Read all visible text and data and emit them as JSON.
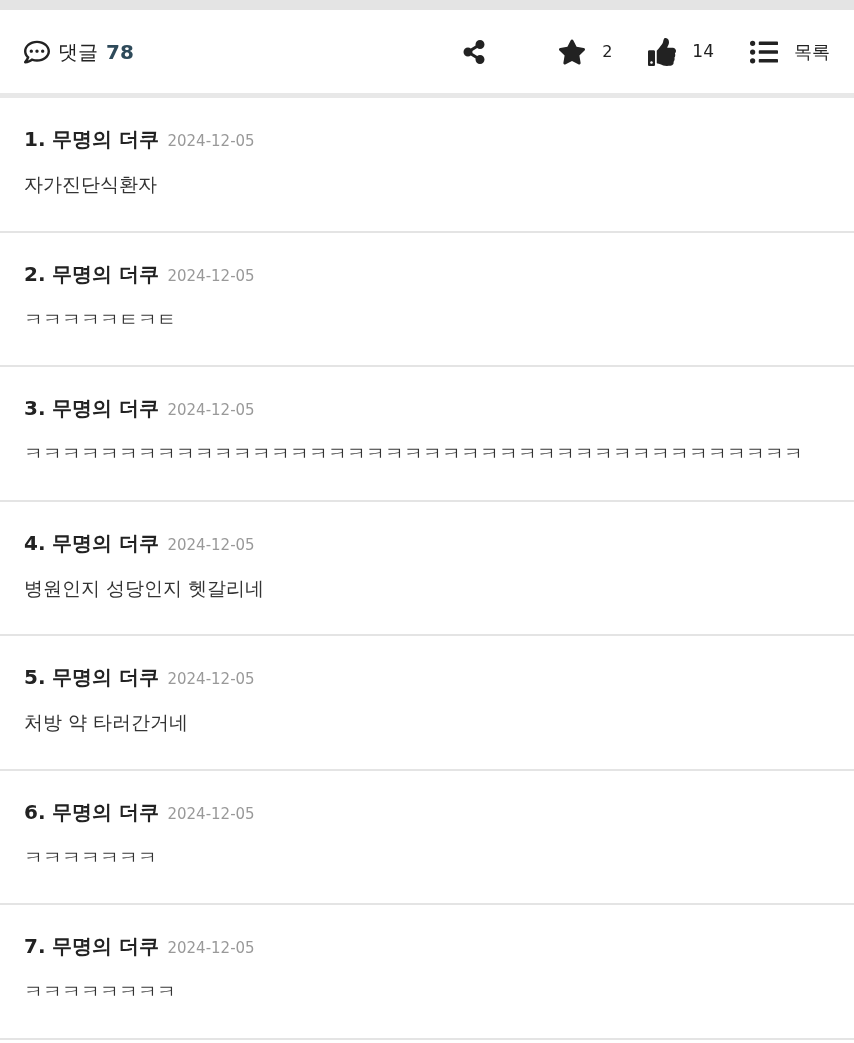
{
  "header": {
    "comments_label": "댓글",
    "comments_count": "78",
    "stars": "2",
    "likes": "14",
    "list_label": "목록"
  },
  "comments": [
    {
      "number": "1.",
      "author": "무명의 더쿠",
      "date": "2024-12-05",
      "text": "자가진단식환자"
    },
    {
      "number": "2.",
      "author": "무명의 더쿠",
      "date": "2024-12-05",
      "text": "ㅋㅋㅋㅋㅋㅌㅋㅌ"
    },
    {
      "number": "3.",
      "author": "무명의 더쿠",
      "date": "2024-12-05",
      "text": "ㅋㅋㅋㅋㅋㅋㅋㅋㅋㅋㅋㅋㅋㅋㅋㅋㅋㅋㅋㅋㅋㅋㅋㅋㅋㅋㅋㅋㅋㅋㅋㅋㅋㅋㅋㅋㅋㅋㅋㅋㅋ"
    },
    {
      "number": "4.",
      "author": "무명의 더쿠",
      "date": "2024-12-05",
      "text": "병원인지 성당인지 헷갈리네"
    },
    {
      "number": "5.",
      "author": "무명의 더쿠",
      "date": "2024-12-05",
      "text": "처방 약 타러간거네"
    },
    {
      "number": "6.",
      "author": "무명의 더쿠",
      "date": "2024-12-05",
      "text": "ㅋㅋㅋㅋㅋㅋㅋ"
    },
    {
      "number": "7.",
      "author": "무명의 더쿠",
      "date": "2024-12-05",
      "text": "ㅋㅋㅋㅋㅋㅋㅋㅋ"
    }
  ]
}
